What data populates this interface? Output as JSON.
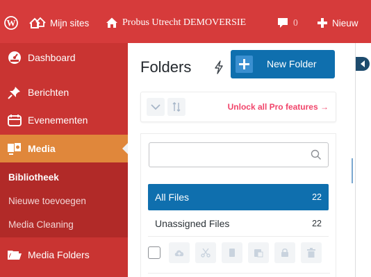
{
  "adminbar": {
    "sites_label": "Mijn sites",
    "site_label": "Probus Utrecht DEMOVERSIE",
    "comments_count": "0",
    "new_label": "Nieuw"
  },
  "sidebar": {
    "items": [
      {
        "label": "Dashboard",
        "icon": "dashboard-icon"
      },
      {
        "label": "Berichten",
        "icon": "pin-icon"
      },
      {
        "label": "Evenementen",
        "icon": "calendar-icon"
      },
      {
        "label": "Media",
        "icon": "media-icon"
      },
      {
        "label": "Media Folders",
        "icon": "folder-icon"
      }
    ],
    "submenu": [
      {
        "label": "Bibliotheek"
      },
      {
        "label": "Nieuwe toevoegen"
      },
      {
        "label": "Media Cleaning"
      }
    ]
  },
  "folders": {
    "title": "Folders",
    "new_folder_label": "New Folder",
    "unlock_label": "Unlock all Pro features →",
    "search_placeholder": "",
    "rows": [
      {
        "label": "All Files",
        "count": "22"
      },
      {
        "label": "Unassigned Files",
        "count": "22"
      }
    ]
  },
  "colors": {
    "adminbar_bg": "#d63b3b",
    "sidebar_bg": "#c93432",
    "submenu_bg": "#b12a28",
    "active_item_bg": "#e0873b",
    "primary_blue": "#0f6fae",
    "pro_pink": "#f1446a"
  }
}
